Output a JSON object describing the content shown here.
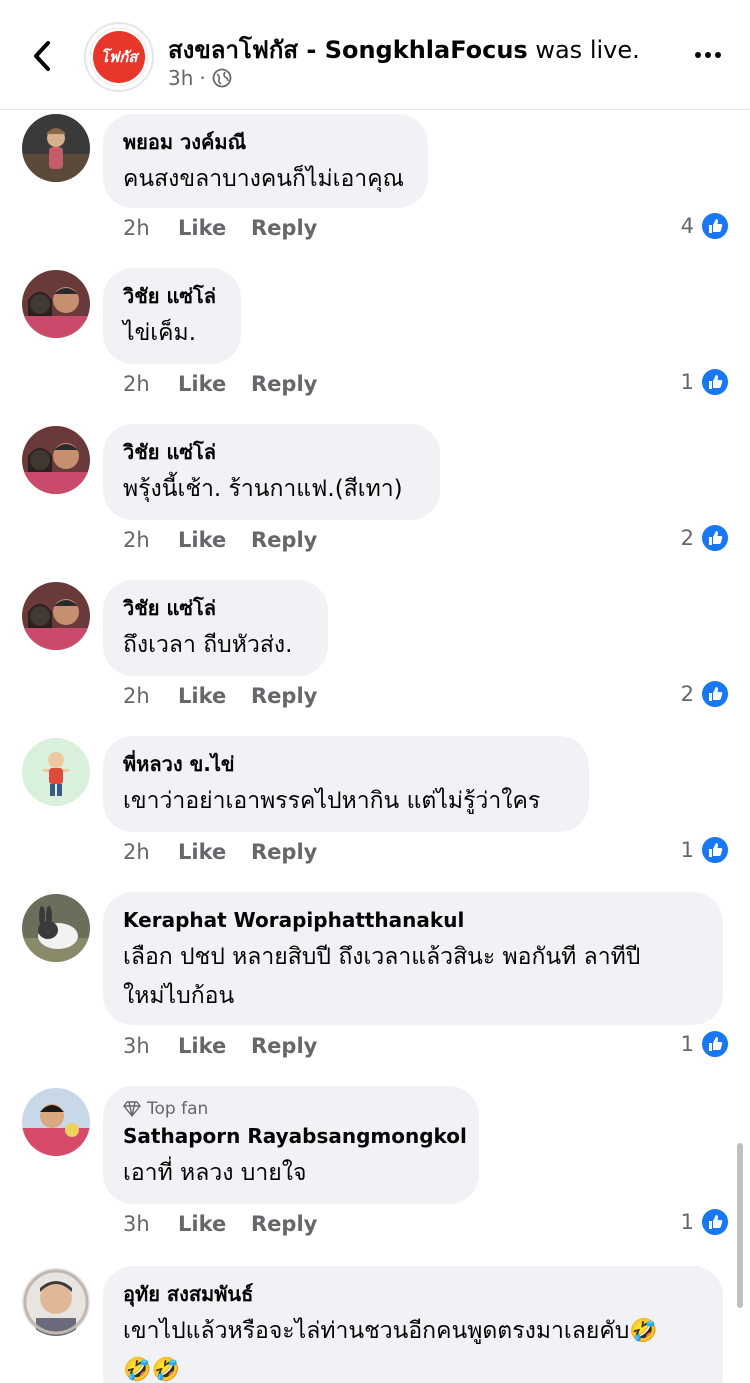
{
  "header": {
    "page_name": "สงขลาโฟกัส - SongkhlaFocus",
    "action": " was live.",
    "time": "3h",
    "separator": "·",
    "logo_text": "โฟกัส"
  },
  "comments": [
    {
      "author": "พยอม วงค์มณี",
      "text": "คนสงขลาบางคนก็ไม่เอาคุณ",
      "time": "2h",
      "like": "Like",
      "reply": "Reply",
      "reactions": "4"
    },
    {
      "author": "วิชัย แซ่โล่",
      "text": "ไข่เค็ม.",
      "time": "2h",
      "like": "Like",
      "reply": "Reply",
      "reactions": "1"
    },
    {
      "author": "วิชัย แซ่โล่",
      "text": "พรุ้งนี้เช้า. ร้านกาแฟ.(สีเทา)",
      "time": "2h",
      "like": "Like",
      "reply": "Reply",
      "reactions": "2"
    },
    {
      "author": "วิชัย แซ่โล่",
      "text": "ถึงเวลา ถีบหัวส่ง.",
      "time": "2h",
      "like": "Like",
      "reply": "Reply",
      "reactions": "2"
    },
    {
      "author": "พี่หลวง ข.ไข่",
      "text": "เขาว่าอย่าเอาพรรคไปหากิน แต่ไม่รู้ว่าใคร",
      "time": "2h",
      "like": "Like",
      "reply": "Reply",
      "reactions": "1"
    },
    {
      "author": "Keraphat Worapiphatthanakul",
      "text_line1": "เลือก ปชป  หลายสิบปี  ถึงเวลาแล้วสินะ  พอกันที ลาทีปี",
      "text_line2": "ใหม่ไบก้อน",
      "time": "3h",
      "like": "Like",
      "reply": "Reply",
      "reactions": "1"
    },
    {
      "badge": "Top fan",
      "author": "Sathaporn Rayabsangmongkol",
      "text": "เอาที่ หลวง บายใจ",
      "time": "3h",
      "like": "Like",
      "reply": "Reply",
      "reactions": "1"
    },
    {
      "author": "อุทัย สงสมพันธ์",
      "text_line1": "เขาไปแล้วหรือจะไล่ท่านชวนอีกคนพูดตรงมาเลยคับ🤣",
      "text_line2": "🤣🤣"
    }
  ],
  "colors": {
    "accent": "#1877f2",
    "bubble": "#f0f2f5",
    "meta": "#65676b",
    "logo": "#e8362a"
  }
}
